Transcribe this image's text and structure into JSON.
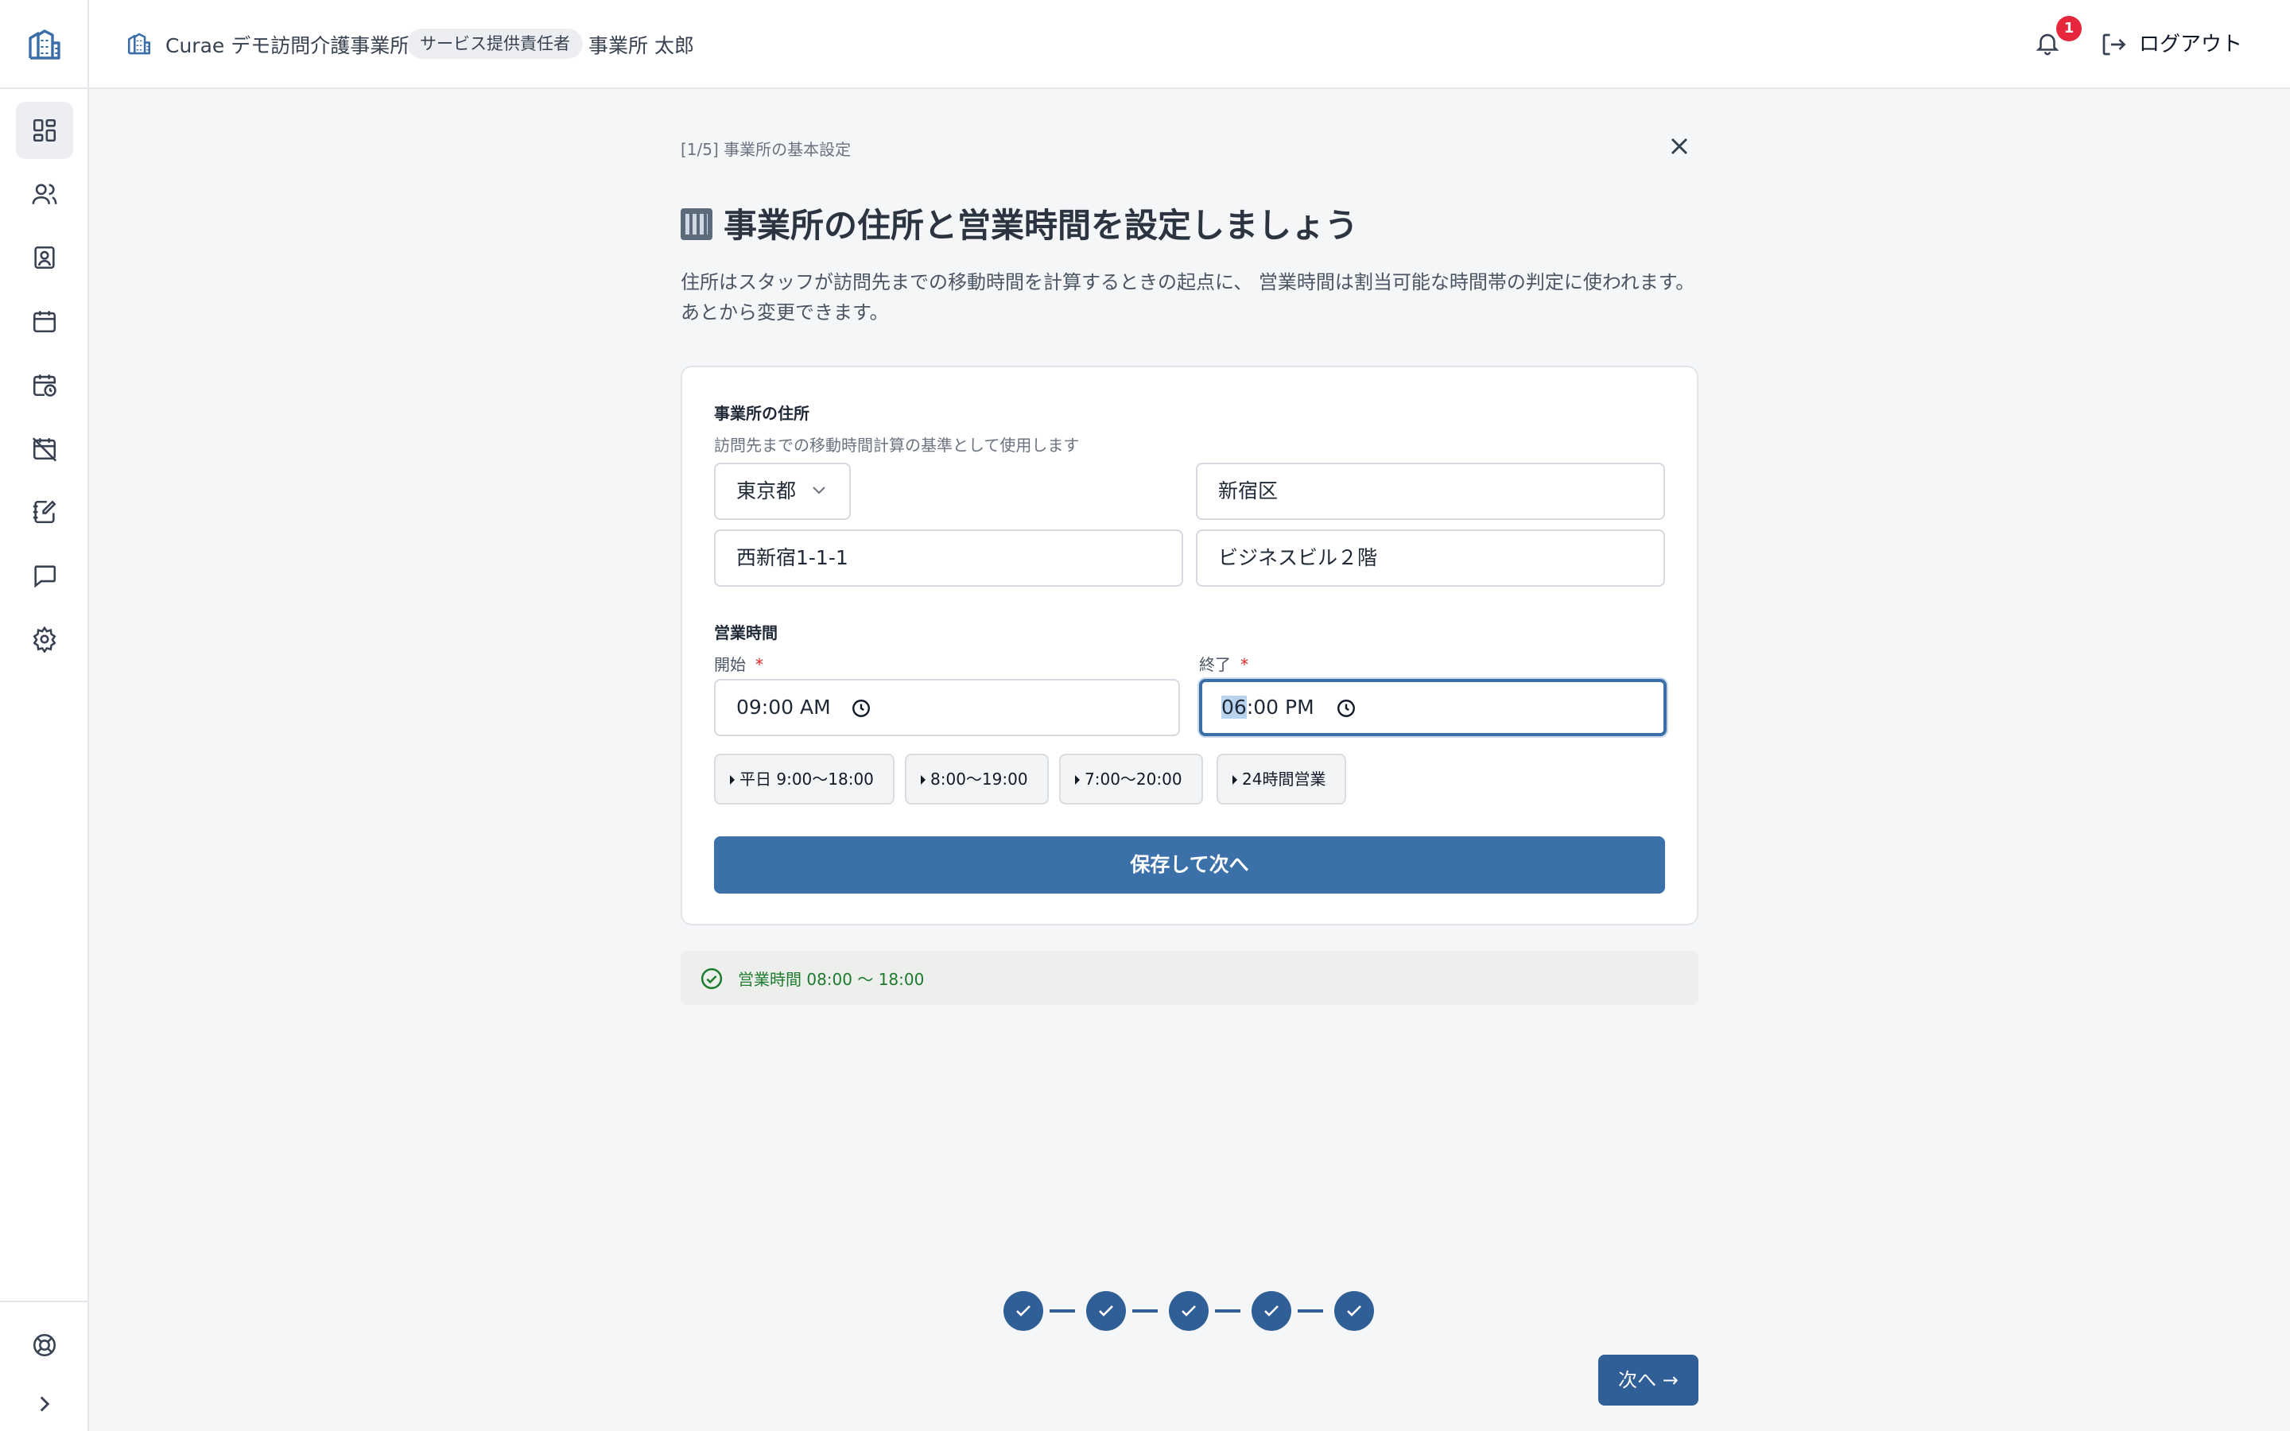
{
  "header": {
    "office_name": "Curae デモ訪問介護事業所",
    "role_badge": "サービス提供責任者",
    "user_name": "事業所 太郎",
    "notification_count": "1",
    "logout_label": "ログアウト"
  },
  "sidebar": {
    "items": [
      {
        "icon": "dashboard-icon",
        "active": true
      },
      {
        "icon": "users-icon"
      },
      {
        "icon": "contact-card-icon"
      },
      {
        "icon": "calendar-icon"
      },
      {
        "icon": "calendar-clock-icon"
      },
      {
        "icon": "calendar-off-icon"
      },
      {
        "icon": "notebook-edit-icon"
      },
      {
        "icon": "message-icon"
      },
      {
        "icon": "settings-icon"
      },
      {
        "icon": "help-lifebuoy-icon"
      },
      {
        "icon": "expand-chevron-icon"
      }
    ]
  },
  "main": {
    "step_label": "[1/5] 事業所の基本設定",
    "title": "事業所の住所と営業時間を設定しましょう",
    "description_line1": "住所はスタッフが訪問先までの移動時間を計算するときの起点に、 営業時間は割当可能な時間帯の判定に使われます。",
    "description_line2": "あとから変更できます。"
  },
  "address": {
    "title": "事業所の住所",
    "help": "訪問先までの移動時間計算の基準として使用します",
    "prefecture": "東京都",
    "city": "新宿区",
    "street": "西新宿1-1-1",
    "building": "ビジネスビル２階"
  },
  "hours": {
    "title": "営業時間",
    "start_label": "開始",
    "end_label": "終了",
    "required_mark": "*",
    "start_value": "09:00 AM",
    "end_value_hour": "06",
    "end_value_rest": ":00 PM",
    "presets": [
      "平日 9:00〜18:00",
      "8:00〜19:00",
      "7:00〜20:00",
      "24時間営業"
    ]
  },
  "save_button": "保存して次へ",
  "status": {
    "text": "営業時間 08:00 〜 18:00",
    "color": "#1e7b2e"
  },
  "stepper": {
    "total": 5,
    "completed": 5
  },
  "next_button": "次へ →",
  "colors": {
    "primary": "#3b70a8",
    "dark_primary": "#2f5f96",
    "badge": "#e5263b",
    "success": "#1e7b2e"
  }
}
